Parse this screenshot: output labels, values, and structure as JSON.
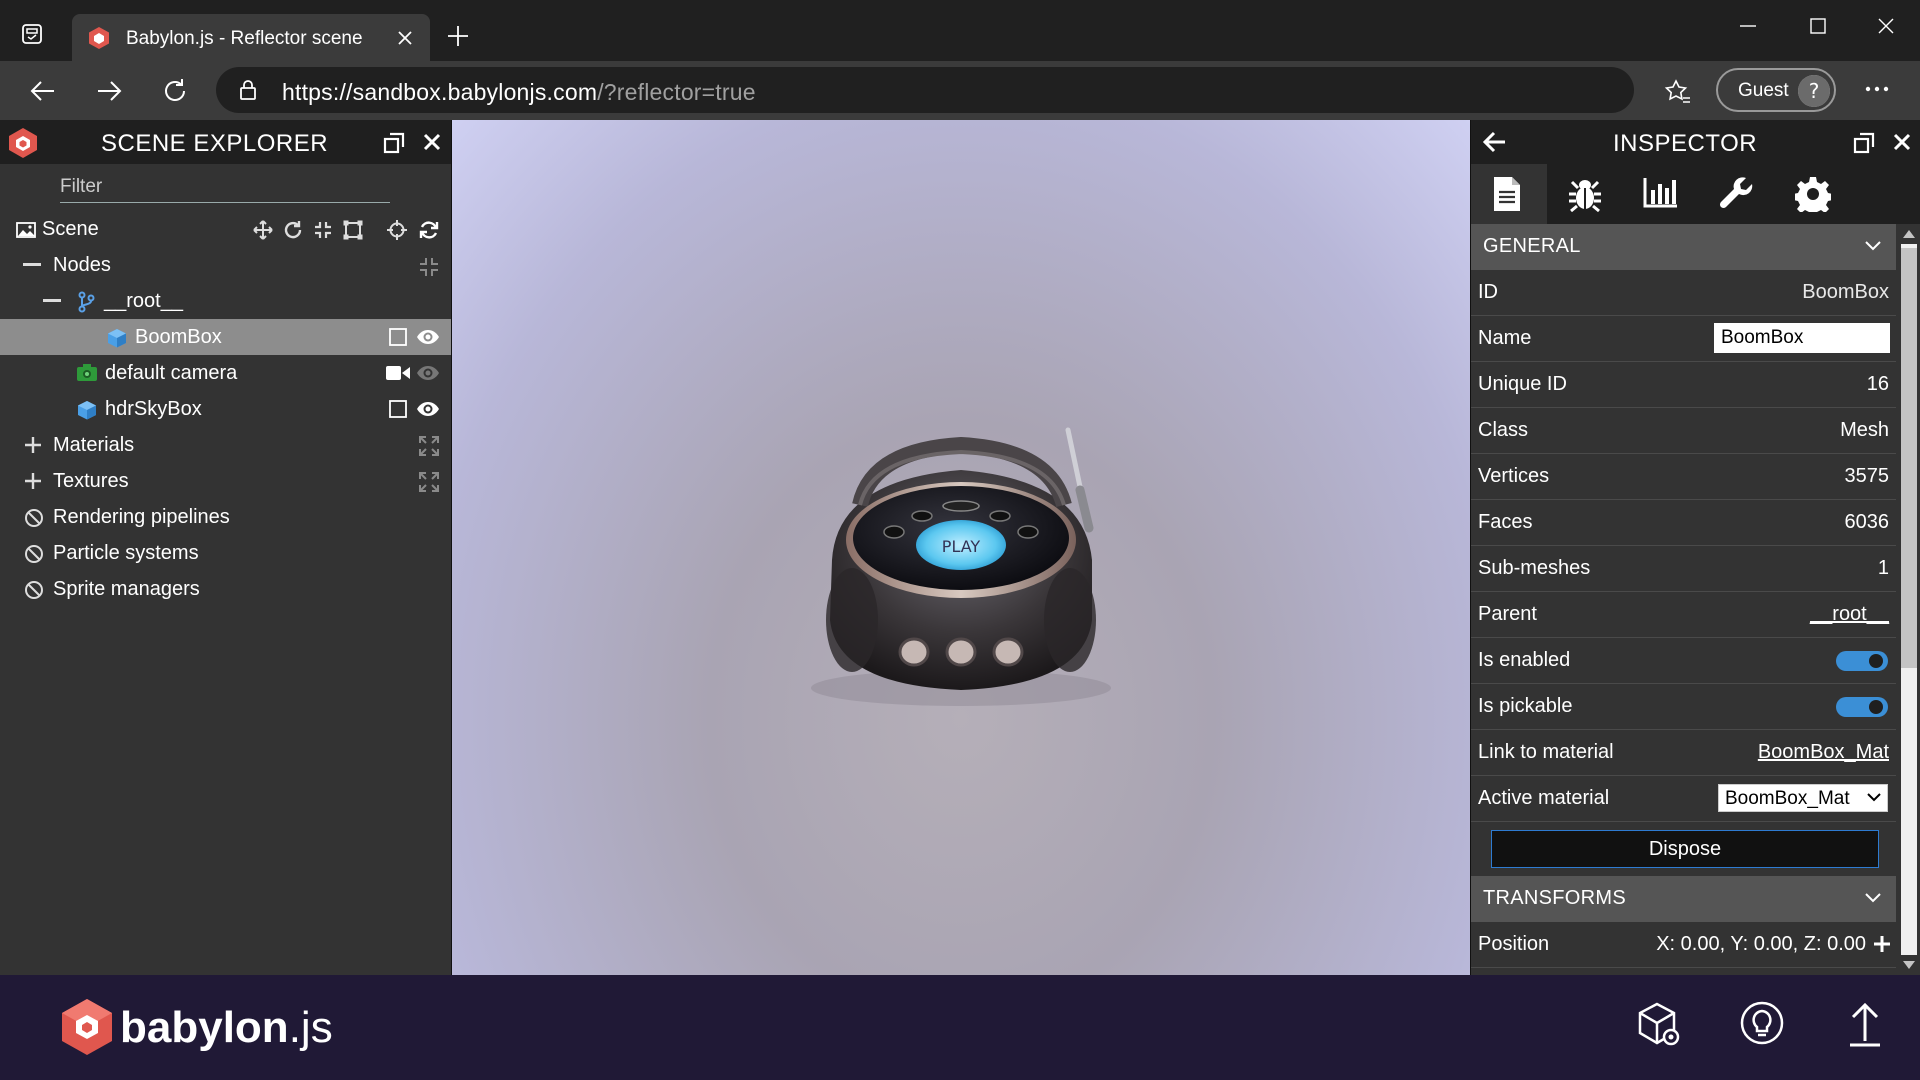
{
  "browser": {
    "tab_title": "Babylon.js - Reflector scene",
    "url_host": "https://sandbox.babylonjs.com",
    "url_rest": "/?reflector=true",
    "profile_label": "Guest"
  },
  "explorer": {
    "title": "SCENE EXPLORER",
    "filter_placeholder": "Filter",
    "scene_label": "Scene",
    "nodes_label": "Nodes",
    "root_label": "__root__",
    "items": [
      {
        "label": "BoomBox"
      },
      {
        "label": "default camera"
      },
      {
        "label": "hdrSkyBox"
      }
    ],
    "sections": [
      {
        "label": "Materials"
      },
      {
        "label": "Textures"
      },
      {
        "label": "Rendering pipelines"
      },
      {
        "label": "Particle systems"
      },
      {
        "label": "Sprite managers"
      }
    ]
  },
  "viewport": {
    "play_label": "PLAY"
  },
  "inspector": {
    "title": "INSPECTOR",
    "general_title": "GENERAL",
    "transforms_title": "TRANSFORMS",
    "props": {
      "id": {
        "label": "ID",
        "value": "BoomBox"
      },
      "name": {
        "label": "Name",
        "value": "BoomBox"
      },
      "unique_id": {
        "label": "Unique ID",
        "value": "16"
      },
      "class": {
        "label": "Class",
        "value": "Mesh"
      },
      "vertices": {
        "label": "Vertices",
        "value": "3575"
      },
      "faces": {
        "label": "Faces",
        "value": "6036"
      },
      "submeshes": {
        "label": "Sub-meshes",
        "value": "1"
      },
      "parent": {
        "label": "Parent",
        "value": "__root__"
      },
      "is_enabled": {
        "label": "Is enabled",
        "value": true
      },
      "is_pickable": {
        "label": "Is pickable",
        "value": true
      },
      "link_material": {
        "label": "Link to material",
        "value": "BoomBox_Mat"
      },
      "active_material": {
        "label": "Active material",
        "value": "BoomBox_Mat"
      },
      "position": {
        "label": "Position",
        "value": "X: 0.00, Y: 0.00, Z: 0.00"
      }
    },
    "dispose_label": "Dispose"
  },
  "footer": {
    "brand": "babylon",
    "brand_suffix": ".js"
  },
  "colors": {
    "panel_bg": "#333333",
    "header_bg": "#1f1f1f",
    "section_bg": "#555555",
    "selected_row": "#8d8d8d",
    "accent_blue": "#3b8fd6",
    "footer_bg": "#201936"
  }
}
